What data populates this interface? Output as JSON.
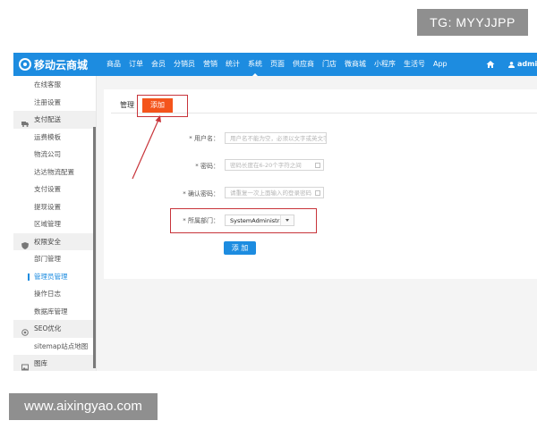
{
  "watermarks": {
    "top": "TG: MYYJJPP",
    "bottom": "www.aixingyao.com"
  },
  "header": {
    "brand": "移动云商城",
    "nav": [
      "商品",
      "订单",
      "会员",
      "分销员",
      "营销",
      "统计",
      "系统",
      "页面",
      "供应商",
      "门店",
      "微商城",
      "小程序",
      "生活号",
      "App"
    ],
    "active_nav": "系统",
    "user": "admin"
  },
  "sidebar": {
    "entries": [
      {
        "type": "item",
        "label": "在线客服"
      },
      {
        "type": "item",
        "label": "注册设置"
      },
      {
        "type": "group",
        "label": "支付配送",
        "icon": "truck-icon"
      },
      {
        "type": "item",
        "label": "运费模板"
      },
      {
        "type": "item",
        "label": "物流公司"
      },
      {
        "type": "item",
        "label": "达达物流配置"
      },
      {
        "type": "item",
        "label": "支付设置"
      },
      {
        "type": "item",
        "label": "提现设置"
      },
      {
        "type": "item",
        "label": "区域管理"
      },
      {
        "type": "group",
        "label": "权限安全",
        "icon": "shield-icon"
      },
      {
        "type": "item",
        "label": "部门管理"
      },
      {
        "type": "item",
        "label": "管理员管理",
        "active": true
      },
      {
        "type": "item",
        "label": "操作日志"
      },
      {
        "type": "item",
        "label": "数据库管理"
      },
      {
        "type": "group",
        "label": "SEO优化",
        "icon": "target-icon"
      },
      {
        "type": "item",
        "label": "sitemap站点地图"
      },
      {
        "type": "group",
        "label": "图库",
        "icon": "image-icon"
      }
    ]
  },
  "tabs": {
    "manage": "管理",
    "add": "添加"
  },
  "form": {
    "username_label": "* 用户名：",
    "username_placeholder": "用户名不能为空，必须以文字或英文字母开头",
    "password_label": "* 密码：",
    "password_placeholder": "密码长度在6-20个字符之间",
    "confirm_label": "* 确认密码：",
    "confirm_placeholder": "请重复一次上面输入的登录密码",
    "dept_label": "* 所属部门：",
    "dept_value": "SystemAdministrator",
    "submit_label": "添 加"
  },
  "colors": {
    "nav_blue": "#1d8ce0",
    "add_tab_orange": "#f4541b",
    "annotation_red": "#c8343a"
  }
}
